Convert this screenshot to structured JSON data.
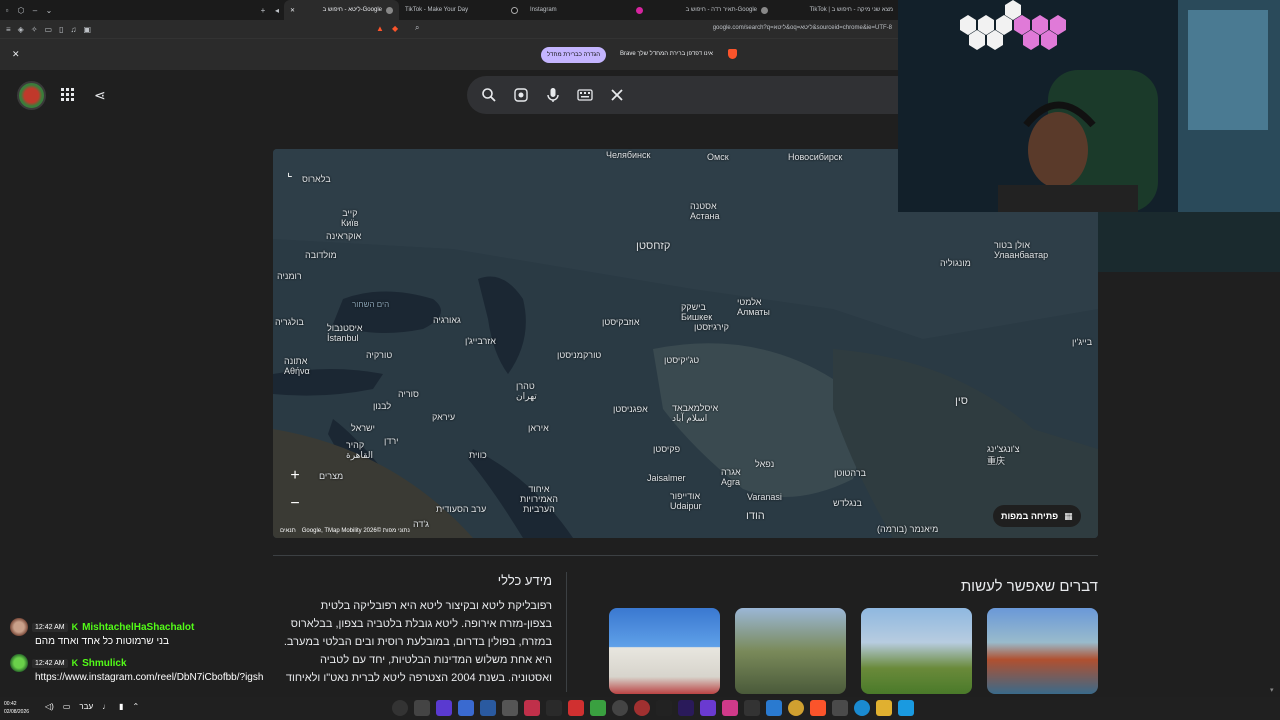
{
  "browser": {
    "tabs": [
      {
        "label": "לִיטא - חיפוש ב-Google",
        "active": true
      },
      {
        "label": "TikTok - Make Your Day",
        "active": false
      },
      {
        "label": "Instagram",
        "active": false
      },
      {
        "label": "תאיר רדה - חיפוש ב-Google",
        "active": false
      },
      {
        "label": "TikTok | מצא שני מיקה - חיפוש ב",
        "active": false
      }
    ],
    "url": "google.com/search?q=ליטא&oq=ליטא&sourceid=chrome&ie=UTF-8",
    "infobar": {
      "button_label": "הגדרה כברירת מחדל",
      "text": "Brave אינו דפדפן ברירת המחדל שלך"
    }
  },
  "map": {
    "labels": [
      {
        "text": "Челябинск",
        "cls": ""
      },
      {
        "text": "Омск",
        "cls": ""
      },
      {
        "text": "Новосибирск",
        "cls": ""
      },
      {
        "text": "בלארוס",
        "cls": ""
      },
      {
        "text": "קייב\nКиїв",
        "cls": ""
      },
      {
        "text": "אוקראינה",
        "cls": ""
      },
      {
        "text": "מולדובה",
        "cls": ""
      },
      {
        "text": "רומניה",
        "cls": ""
      },
      {
        "text": "בולגריה",
        "cls": ""
      },
      {
        "text": "הים השחור",
        "cls": "sea"
      },
      {
        "text": "איסטנבול\nİstanbul",
        "cls": ""
      },
      {
        "text": "גאורגיה",
        "cls": ""
      },
      {
        "text": "אזרבייג'ן",
        "cls": ""
      },
      {
        "text": "טורקיה",
        "cls": ""
      },
      {
        "text": "אתונה\nΑθήνα",
        "cls": ""
      },
      {
        "text": "אסטנה\nАстана",
        "cls": ""
      },
      {
        "text": "קזחסטן",
        "cls": "big"
      },
      {
        "text": "בישקק\nБишкек",
        "cls": ""
      },
      {
        "text": "אלמטי\nАлматы",
        "cls": ""
      },
      {
        "text": "קירגיזסטן",
        "cls": ""
      },
      {
        "text": "אוזבקיסטן",
        "cls": ""
      },
      {
        "text": "טורקמניסטן",
        "cls": ""
      },
      {
        "text": "טג'יקיסטן",
        "cls": ""
      },
      {
        "text": "אולן בטור\nУлаанбаатар",
        "cls": ""
      },
      {
        "text": "מונגוליה",
        "cls": ""
      },
      {
        "text": "בייג'ין",
        "cls": ""
      },
      {
        "text": "סין",
        "cls": "big"
      },
      {
        "text": "סוריה",
        "cls": ""
      },
      {
        "text": "לבנון",
        "cls": ""
      },
      {
        "text": "עיראק",
        "cls": ""
      },
      {
        "text": "טהרן\nتهران",
        "cls": ""
      },
      {
        "text": "אפגניסטן",
        "cls": ""
      },
      {
        "text": "איסלמאבאד\nاسلام آباد",
        "cls": ""
      },
      {
        "text": "איראן",
        "cls": ""
      },
      {
        "text": "ישראל",
        "cls": ""
      },
      {
        "text": "קהיר\nالقاهرة",
        "cls": ""
      },
      {
        "text": "ירדן",
        "cls": ""
      },
      {
        "text": "כווית",
        "cls": ""
      },
      {
        "text": "פקיסטן",
        "cls": ""
      },
      {
        "text": "נפאל",
        "cls": ""
      },
      {
        "text": "צ'ונגצ'ינג\n重庆",
        "cls": ""
      },
      {
        "text": "מצרים",
        "cls": ""
      },
      {
        "text": "ערב הסעודית",
        "cls": ""
      },
      {
        "text": "איחוד\nהאמירויות\nהערביות",
        "cls": ""
      },
      {
        "text": "Jaisalmer",
        "cls": ""
      },
      {
        "text": "אגרה\nAgra",
        "cls": ""
      },
      {
        "text": "אודייפור\nUdaipur",
        "cls": ""
      },
      {
        "text": "Varanasi",
        "cls": ""
      },
      {
        "text": "ברהטוטן",
        "cls": ""
      },
      {
        "text": "בנגלדש",
        "cls": ""
      },
      {
        "text": "הודו",
        "cls": "big"
      },
      {
        "text": "מיאנמר (בורמה)",
        "cls": ""
      },
      {
        "text": "ג'דה",
        "cls": ""
      }
    ],
    "open_map_label": "פתיחה במפות",
    "credits_left": "תנאים",
    "credits_right": "Google, TMap Mobility 2026© נתוני מפות",
    "zoom_in": "+",
    "zoom_out": "−"
  },
  "panel": {
    "things_to_do_title": "דברים שאפשר לעשות",
    "general_info_title": "מידע כללי",
    "general_info_text": "רפובליקת ליטא ובקיצור ליטא היא רפובליקה בלטית בצפון-מזרח אירופה. ליטא גובלת בלטביה בצפון, בבלארוס במזרח, בפולין בדרום, במובלעת רוסית ובים הבלטי במערב. היא אחת משלוש המדינות הבלטיות, יחד עם לטביה ואסטוניה. בשנת 2004 הצטרפה ליטא לברית נאט\"ו ולאיחוד האירופי."
  },
  "chat": [
    {
      "time": "12:42 AM",
      "badge": "K",
      "user": "MishtachelHaShachalot",
      "message": "בני שרמוטות כל אחד ואחד מהם"
    },
    {
      "time": "12:42 AM",
      "badge": "K",
      "user": "Shmulick",
      "message": "https://www.instagram.com/reel/DbN7iCbofbb/?igsh"
    }
  ],
  "taskbar": {
    "time": "00:42",
    "date": "02/08/2026",
    "lang": "עבר"
  },
  "colors": {
    "info_button": "#c4b5ff",
    "kick_green": "#53fc18",
    "map_land": "#2a3a44"
  }
}
